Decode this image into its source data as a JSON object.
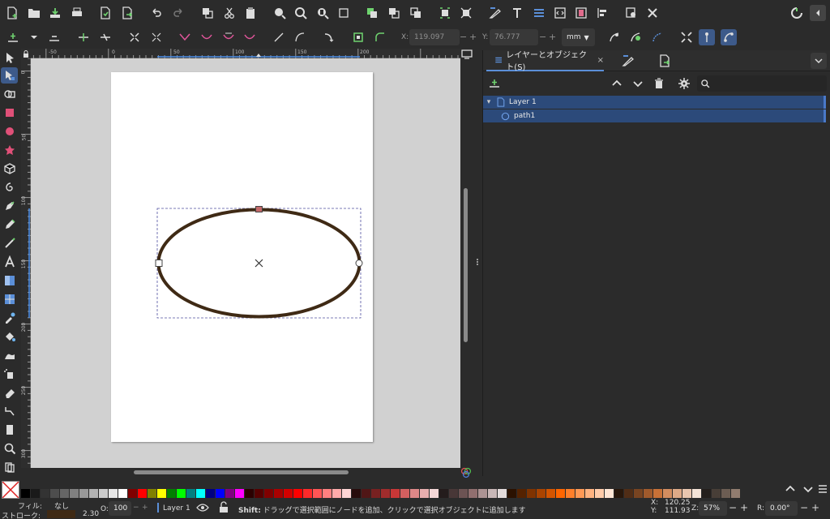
{
  "control_bar": {
    "x_label": "X:",
    "x_value": "119.097",
    "y_label": "Y:",
    "y_value": "76.777",
    "unit": "mm",
    "minus": "−",
    "plus": "+"
  },
  "rulers": {
    "horizontal": [
      "-50",
      "0",
      "50",
      "100",
      "150",
      "200"
    ],
    "vertical": [
      "0",
      "50",
      "100",
      "150",
      "200",
      "250",
      "300"
    ]
  },
  "canvas": {
    "ellipse_stroke": "#3f2a15",
    "page_color": "#ffffff",
    "desk_color": "#d1d1d1"
  },
  "dock": {
    "tab_label": "レイヤーとオブジェクト(S)",
    "close_glyph": "×",
    "layer_name": "Layer 1",
    "object_name": "path1",
    "expand_glyph": "▾"
  },
  "status": {
    "fill_label": "フィル:",
    "fill_value": "なし",
    "stroke_label": "ストローク:",
    "stroke_width": "2.30",
    "stroke_color": "#3f2a15",
    "opacity_label": "O:",
    "opacity_value": "100",
    "layer_indicator": "Layer 1",
    "hint_bold": "Shift:",
    "hint_text": " ドラッグで選択範囲にノードを追加、クリックで選択オブジェクトに追加します",
    "cursor_x_label": "X:",
    "cursor_x": "120.25",
    "cursor_y_label": "Y:",
    "cursor_y": "111.93",
    "zoom_label": "Z:",
    "zoom_value": "57%",
    "rotation_label": "R:",
    "rotation_value": "0.00°",
    "minus": "−",
    "plus": "+"
  },
  "palette": [
    "#000000",
    "#1a1a1a",
    "#333333",
    "#4d4d4d",
    "#666666",
    "#808080",
    "#999999",
    "#b3b3b3",
    "#cccccc",
    "#e6e6e6",
    "#ffffff",
    "#800000",
    "#ff0000",
    "#808000",
    "#ffff00",
    "#008000",
    "#00ff00",
    "#008080",
    "#00ffff",
    "#000080",
    "#0000ff",
    "#800080",
    "#ff00ff",
    "#2b0000",
    "#550000",
    "#800000",
    "#aa0000",
    "#d40000",
    "#ff0000",
    "#ff2a2a",
    "#ff5555",
    "#ff8080",
    "#ffaaaa",
    "#ffd5d5",
    "#280b0b",
    "#501616",
    "#782121",
    "#a02c2c",
    "#c83737",
    "#d35f5f",
    "#de8787",
    "#e9afaf",
    "#f4d7d7",
    "#241c1c",
    "#483737",
    "#6c5353",
    "#916f6f",
    "#ac9393",
    "#c8b7b7",
    "#e3dbdb",
    "#2b1100",
    "#552200",
    "#803300",
    "#aa4400",
    "#d45500",
    "#ff6600",
    "#ff7f2a",
    "#ff9955",
    "#ffb380",
    "#ffccaa",
    "#ffe6d5",
    "#28170b",
    "#502d16",
    "#784421",
    "#a05a2c",
    "#c87137",
    "#d38d5f",
    "#deaa87",
    "#e9c6af",
    "#f4e3d7",
    "#241f1c",
    "#483e37",
    "#6c5d53",
    "#917c6f"
  ]
}
